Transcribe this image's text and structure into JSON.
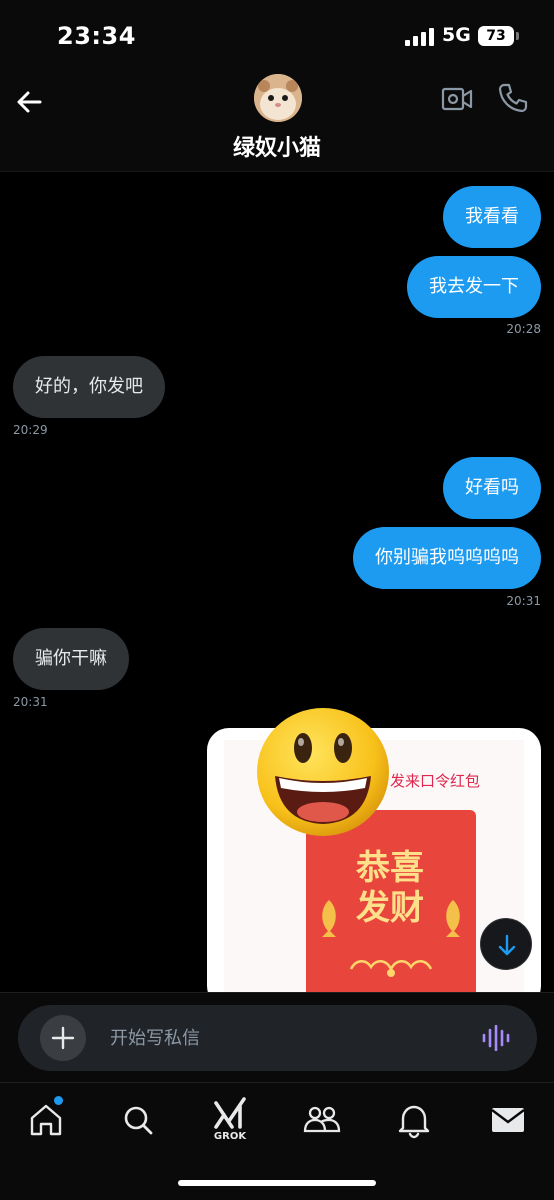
{
  "status_bar": {
    "time": "23:34",
    "network": "5G",
    "battery": "73"
  },
  "header": {
    "contact_name": "绿奴小猫"
  },
  "messages": [
    {
      "text": "我看看",
      "direction": "out"
    },
    {
      "text": "我去发一下",
      "direction": "out",
      "time": "20:28"
    },
    {
      "text": "好的，你发吧",
      "direction": "in",
      "time": "20:29"
    },
    {
      "text": "好看吗",
      "direction": "out"
    },
    {
      "text": "你别骗我呜呜呜呜",
      "direction": "out",
      "time": "20:31"
    },
    {
      "text": "骗你干嘛",
      "direction": "in",
      "time": "20:31"
    }
  ],
  "red_packet_card": {
    "title": "发来口令红包",
    "packet_text": "恭喜发财"
  },
  "composer": {
    "placeholder": "开始写私信"
  },
  "bottom_nav": {
    "items": [
      "home",
      "search",
      "grok",
      "communities",
      "notifications",
      "messages"
    ],
    "grok_label": "GROK"
  },
  "colors": {
    "accent": "#1d9bf0",
    "incoming_bubble": "#2f3336",
    "background": "#000000",
    "voice_icon": "#a78bfa"
  }
}
